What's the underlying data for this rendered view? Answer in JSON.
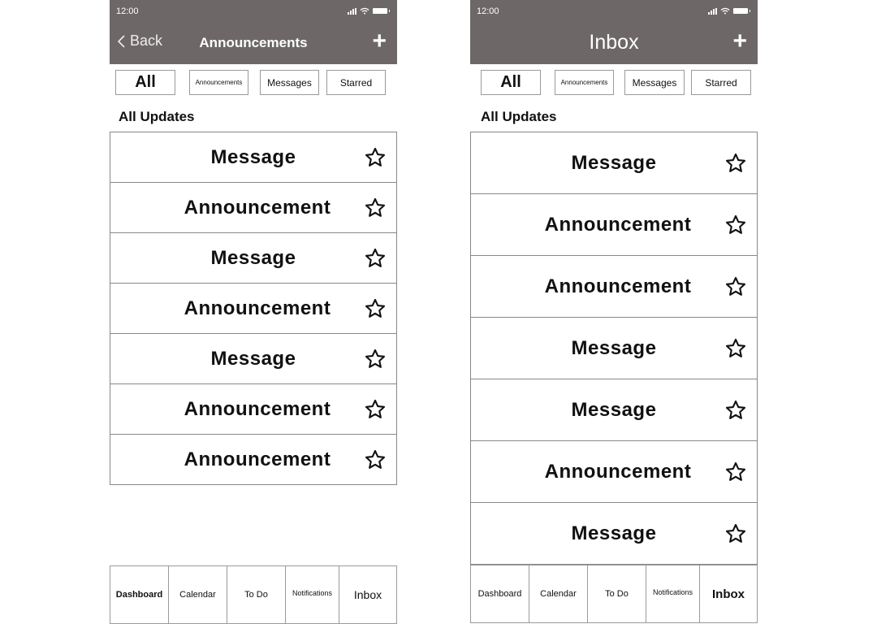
{
  "screens": {
    "left": {
      "status_time": "12:00",
      "back_label": "Back",
      "title": "Announcements",
      "add_icon": "plus-icon",
      "filters": [
        "All",
        "Announcements",
        "Messages",
        "Starred"
      ],
      "section_title": "All Updates",
      "items": [
        "Message",
        "Announcement",
        "Message",
        "Announcement",
        "Message",
        "Announcement",
        "Announcement"
      ],
      "nav": [
        "Dashboard",
        "Calendar",
        "To Do",
        "Notifications",
        "Inbox"
      ],
      "nav_active": "Dashboard"
    },
    "right": {
      "status_time": "12:00",
      "title": "Inbox",
      "add_icon": "plus-icon",
      "filters": [
        "All",
        "Announcements",
        "Messages",
        "Starred"
      ],
      "section_title": "All Updates",
      "items": [
        "Message",
        "Announcement",
        "Announcement",
        "Message",
        "Message",
        "Announcement",
        "Message"
      ],
      "nav": [
        "Dashboard",
        "Calendar",
        "To Do",
        "Notifications",
        "Inbox"
      ],
      "nav_active": "Inbox"
    }
  },
  "colors": {
    "header_bg": "#6d6867",
    "border": "#9a9a9a"
  }
}
